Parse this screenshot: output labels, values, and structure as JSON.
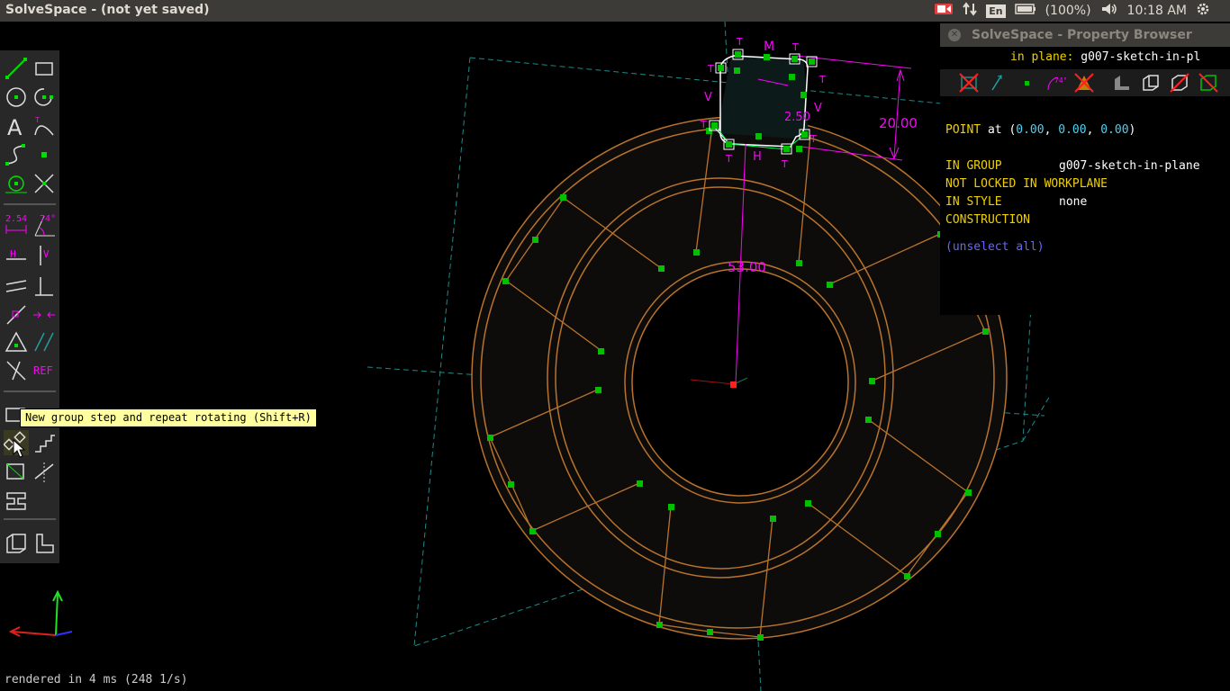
{
  "window": {
    "title": "SolveSpace - (not yet saved)"
  },
  "tray": {
    "lang": "En",
    "battery": "(100%)",
    "clock": "10:18 AM"
  },
  "tooltip": "New group step and repeat rotating (Shift+R)",
  "status": "rendered in 4 ms (248 1/s)",
  "toolbar_labels": {
    "dist": "2.54",
    "angle": "74°",
    "h": "H",
    "v": "V",
    "ref": "REF"
  },
  "sketch_labels": {
    "dim_vertical": "20.00",
    "dim_length": "53.00",
    "dim_small": "2.50",
    "m": "M",
    "h": "H",
    "v": "V",
    "t": "T"
  },
  "property_browser": {
    "title": "SolveSpace - Property Browser",
    "plane_label": "in plane:",
    "plane_value": "g007-sketch-in-pl",
    "point_label": "POINT",
    "point_at": "at",
    "coord_open": "(",
    "x": "0.00",
    "y": "0.00",
    "z": "0.00",
    "coord_close": ")",
    "sep": ",",
    "in_group_label": "IN GROUP",
    "in_group_value": "g007-sketch-in-plane",
    "not_locked": "NOT LOCKED IN WORKPLANE",
    "in_style_label": "IN STYLE",
    "in_style_value": "none",
    "construction": "CONSTRUCTION",
    "unselect_all": "(unselect all)"
  },
  "colors": {
    "sketch": "#b8732c",
    "point": "#00c000",
    "constraint": "#ff00ff",
    "workplane": "#1e8a8a",
    "toolbar_fg": "#00e000"
  }
}
